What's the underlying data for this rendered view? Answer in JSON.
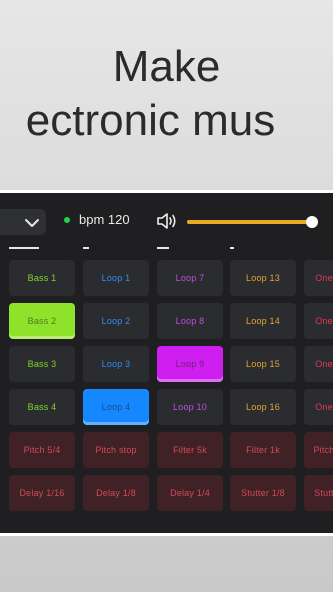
{
  "headline": {
    "line1": "Make",
    "line2": "ectronic mus"
  },
  "toolbar": {
    "bpm_label": "bpm 120",
    "volume_level": 0.98,
    "colors": {
      "led": "#22d14a",
      "volume_fill": "#e9a924"
    }
  },
  "icons": {
    "dropdown": "chevron-down-icon",
    "volume": "speaker-icon"
  },
  "pad_colors": {
    "bass_text": "#7fd62a",
    "loop_blue_text": "#2f8df5",
    "loop_purple_text": "#c04ee0",
    "loop_orange_text": "#e6a532",
    "loop_red_text": "#e0394e",
    "effect_text": "#d24a55",
    "active_bass": "#8fe22a",
    "active_blue": "#1588ff",
    "active_purple": "#cf1ff0"
  },
  "pads": [
    [
      {
        "label": "Bass 1",
        "color": "#7fd62a"
      },
      {
        "label": "Loop 1",
        "color": "#2f8df5"
      },
      {
        "label": "Loop 7",
        "color": "#c04ee0"
      },
      {
        "label": "Loop 13",
        "color": "#e6a532"
      },
      {
        "label": "One",
        "color": "#e0394e"
      }
    ],
    [
      {
        "label": "Bass 2",
        "color": "#7fd62a",
        "active": "#8fe22a"
      },
      {
        "label": "Loop 2",
        "color": "#2f8df5"
      },
      {
        "label": "Loop 8",
        "color": "#c04ee0"
      },
      {
        "label": "Loop 14",
        "color": "#e6a532"
      },
      {
        "label": "One",
        "color": "#e0394e"
      }
    ],
    [
      {
        "label": "Bass 3",
        "color": "#7fd62a"
      },
      {
        "label": "Loop 3",
        "color": "#2f8df5"
      },
      {
        "label": "Loop 9",
        "color": "#c04ee0",
        "active": "#cf1ff0"
      },
      {
        "label": "Loop 15",
        "color": "#e6a532"
      },
      {
        "label": "One",
        "color": "#e0394e"
      }
    ],
    [
      {
        "label": "Bass 4",
        "color": "#7fd62a"
      },
      {
        "label": "Loop 4",
        "color": "#2f8df5",
        "active": "#1588ff"
      },
      {
        "label": "Loop 10",
        "color": "#c04ee0"
      },
      {
        "label": "Loop 16",
        "color": "#e6a532"
      },
      {
        "label": "One",
        "color": "#e0394e"
      }
    ],
    [
      {
        "label": "Pitch 5/4",
        "color": "#d24a55",
        "effect": true
      },
      {
        "label": "Pitch stop",
        "color": "#d24a55",
        "effect": true
      },
      {
        "label": "Filter 5k",
        "color": "#d24a55",
        "effect": true
      },
      {
        "label": "Filter 1k",
        "color": "#d24a55",
        "effect": true
      },
      {
        "label": "Pitch",
        "color": "#d24a55",
        "effect": true
      }
    ],
    [
      {
        "label": "Delay 1/16",
        "color": "#d24a55",
        "effect": true
      },
      {
        "label": "Delay 1/8",
        "color": "#d24a55",
        "effect": true
      },
      {
        "label": "Delay 1/4",
        "color": "#d24a55",
        "effect": true
      },
      {
        "label": "Stutter 1/8",
        "color": "#d24a55",
        "effect": true
      },
      {
        "label": "Stutt",
        "color": "#d24a55",
        "effect": true
      }
    ]
  ]
}
